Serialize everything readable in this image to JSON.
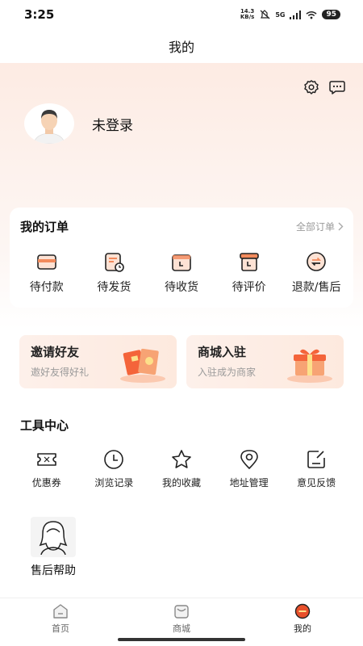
{
  "status_bar": {
    "time": "3:25",
    "net_speed_value": "14.3",
    "net_speed_unit": "KB/s",
    "network": "5G",
    "battery": "95"
  },
  "header": {
    "title": "我的"
  },
  "profile": {
    "login_text": "未登录"
  },
  "orders": {
    "title": "我的订单",
    "all_link": "全部订单",
    "items": [
      {
        "label": "待付款",
        "icon": "wallet-icon"
      },
      {
        "label": "待发货",
        "icon": "shipping-icon"
      },
      {
        "label": "待收货",
        "icon": "receive-box-icon"
      },
      {
        "label": "待评价",
        "icon": "review-box-icon"
      },
      {
        "label": "退款/售后",
        "icon": "refund-icon"
      }
    ]
  },
  "banners": {
    "invite": {
      "title": "邀请好友",
      "subtitle": "邀好友得好礼"
    },
    "merchant": {
      "title": "商城入驻",
      "subtitle": "入驻成为商家"
    }
  },
  "tools": {
    "title": "工具中心",
    "items": [
      {
        "label": "优惠券",
        "icon": "coupon-icon"
      },
      {
        "label": "浏览记录",
        "icon": "clock-icon"
      },
      {
        "label": "我的收藏",
        "icon": "star-icon"
      },
      {
        "label": "地址管理",
        "icon": "location-icon"
      },
      {
        "label": "意见反馈",
        "icon": "feedback-icon"
      }
    ]
  },
  "help": {
    "label": "售后帮助"
  },
  "tabbar": {
    "items": [
      {
        "label": "首页",
        "icon": "home-icon"
      },
      {
        "label": "商城",
        "icon": "shop-icon"
      },
      {
        "label": "我的",
        "icon": "profile-tab-icon",
        "active": true
      }
    ]
  },
  "colors": {
    "accent": "#e8502b",
    "accent_light": "#f7a37a",
    "hero_bg": "#fdebe3"
  }
}
